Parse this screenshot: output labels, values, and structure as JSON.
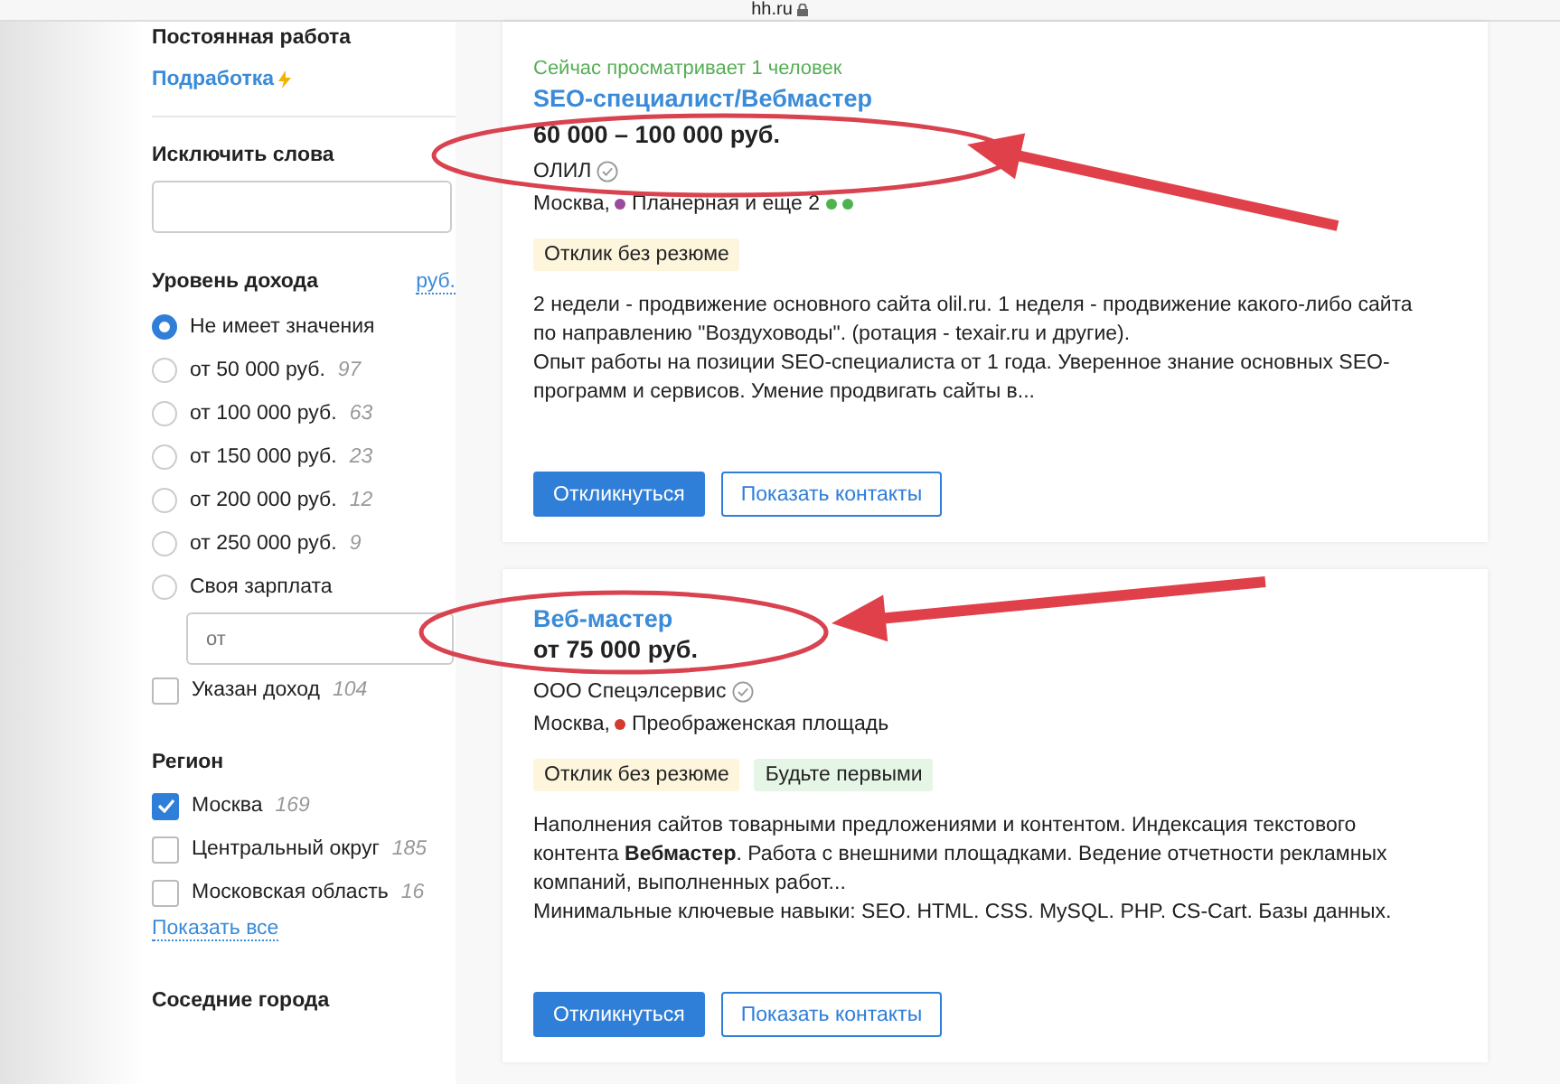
{
  "browser_bar": {
    "address": "hh.ru",
    "secure": true
  },
  "sidebar": {
    "employment": {
      "item": "Постоянная работа",
      "link": "Подработка"
    },
    "exclude_words": {
      "title": "Исключить слова"
    },
    "income": {
      "title": "Уровень дохода",
      "currency": "руб.",
      "options": [
        {
          "label": "Не имеет значения",
          "selected": true
        },
        {
          "label": "от 50 000 руб.",
          "count": "97",
          "selected": false
        },
        {
          "label": "от 100 000 руб.",
          "count": "63",
          "selected": false
        },
        {
          "label": "от 150 000 руб.",
          "count": "23",
          "selected": false
        },
        {
          "label": "от 200 000 руб.",
          "count": "12",
          "selected": false
        },
        {
          "label": "от 250 000 руб.",
          "count": "9",
          "selected": false
        },
        {
          "label": "Своя зарплата",
          "selected": false
        }
      ],
      "custom_placeholder": "от",
      "salary_specified": {
        "label": "Указан доход",
        "count": "104",
        "checked": false
      }
    },
    "region": {
      "title": "Регион",
      "items": [
        {
          "label": "Москва",
          "count": "169",
          "checked": true
        },
        {
          "label": "Центральный округ",
          "count": "185",
          "checked": false
        },
        {
          "label": "Московская область",
          "count": "16",
          "checked": false
        }
      ],
      "show_all": "Показать все"
    },
    "nearby": {
      "title": "Соседние города"
    }
  },
  "vacancies": [
    {
      "viewers": "Сейчас просматривает 1 человек",
      "title": "SEO-специалист/Вебмастер",
      "salary": "60 000 – 100 000 руб.",
      "company": "ОЛИЛ",
      "verified": true,
      "city": "Москва,",
      "stations": [
        {
          "name": "Планерная и еще 2",
          "color": "#9c4a9e"
        }
      ],
      "extra_dots": [
        {
          "color": "#4db34d"
        },
        {
          "color": "#4db34d"
        }
      ],
      "tags": [
        {
          "kind": "no_resume",
          "label": "Отклик без резюме"
        }
      ],
      "description": [
        "2 недели - продвижение основного сайта olil.ru. 1 неделя - продвижение какого-либо сайта по направлению \"Воздуховоды\". (ротация - texair.ru и другие).",
        "Опыт работы на позиции SEO-специалиста от 1 года. Уверенное знание основных SEO-программ и сервисов. Умение продвигать сайты в..."
      ],
      "buttons": {
        "respond": "Откликнуться",
        "contacts": "Показать контакты"
      }
    },
    {
      "title": "Веб-мастер",
      "salary": "от 75 000 руб.",
      "company": "ООО Спецэлсервис",
      "verified": true,
      "city": "Москва,",
      "stations": [
        {
          "name": "Преображенская площадь",
          "color": "#d43a2f"
        }
      ],
      "tags": [
        {
          "kind": "no_resume",
          "label": "Отклик без резюме"
        },
        {
          "kind": "be_first",
          "label": "Будьте первыми"
        }
      ],
      "description": [
        "Наполнения сайтов товарными предложениями и контентом. Индексация текстового контента **Вебмастер**. Работа с внешними площадками. Ведение отчетности рекламных компаний, выполненных работ...",
        "Минимальные ключевые навыки: SEO. HTML. CSS. MySQL. PHP. CS-Cart. Базы данных."
      ],
      "buttons": {
        "respond": "Откликнуться",
        "contacts": "Показать контакты"
      }
    }
  ],
  "annotations": [
    {
      "kind": "ellipse"
    },
    {
      "kind": "arrow"
    },
    {
      "kind": "ellipse"
    },
    {
      "kind": "arrow"
    }
  ]
}
